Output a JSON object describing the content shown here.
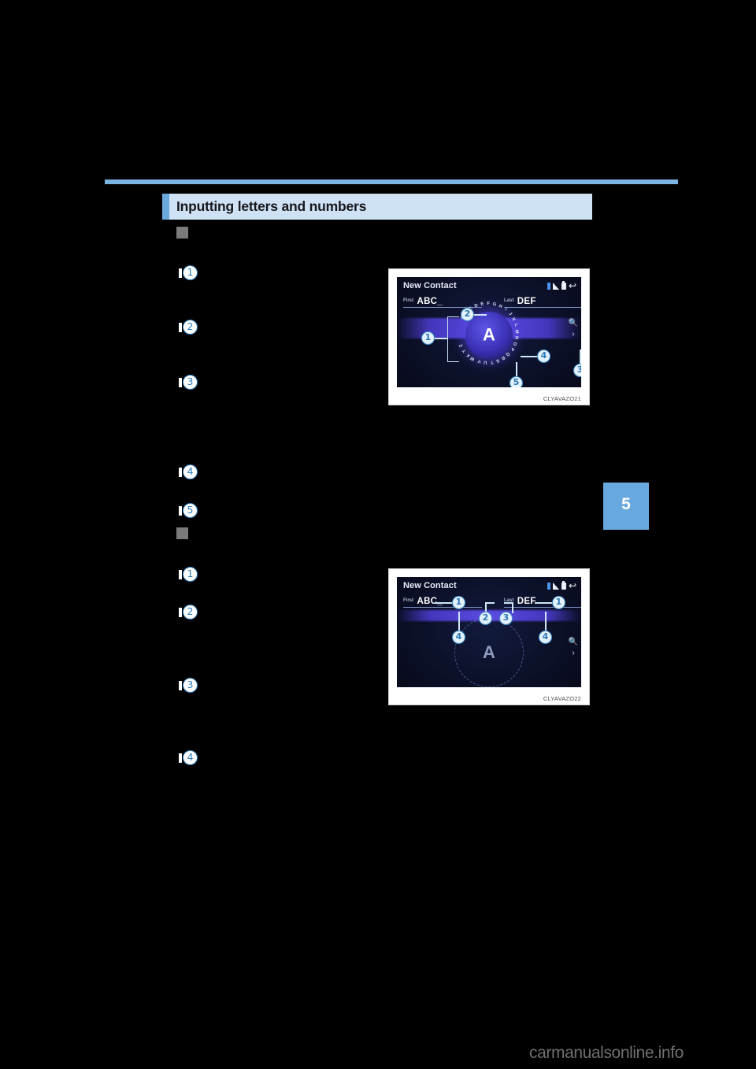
{
  "page": {
    "background_color": "#000000",
    "rule_color": "#7cb3e3",
    "watermark": "carmanualsonline.info"
  },
  "section": {
    "title": "Inputting letters and numbers",
    "title_bg": "#cfe2f5",
    "accent_color": "#6aa9dd"
  },
  "chapter_tab": {
    "number": "5",
    "color": "#67a9df"
  },
  "subsections": [
    {
      "marker": "square",
      "callouts": [
        "1",
        "2",
        "3",
        "4",
        "5"
      ]
    },
    {
      "marker": "square",
      "callouts": [
        "1",
        "2",
        "3",
        "4"
      ]
    }
  ],
  "figures": [
    {
      "caption": "CLYAVAZO21",
      "screen": {
        "title": "New Contact",
        "status_icons": [
          "bluetooth-icon",
          "signal-icon",
          "battery-icon",
          "back-arrow-icon"
        ],
        "fields": [
          {
            "label": "First",
            "value": "ABC_"
          },
          {
            "label": "Last",
            "value": "DEF"
          }
        ],
        "center_character": "A",
        "wheel_characters": [
          "A",
          "B",
          "C",
          "D",
          "E",
          "F",
          "G",
          "H",
          "I",
          "J",
          "K",
          "L",
          "M",
          "N",
          "O",
          "P",
          "Q",
          "R",
          "S",
          "T",
          "U",
          "V",
          "W",
          "X",
          "Y",
          "Z"
        ],
        "side_tools": [
          "search-icon",
          "chevron-right-icon"
        ],
        "callouts": [
          "1",
          "2",
          "3",
          "4",
          "5"
        ]
      }
    },
    {
      "caption": "CLYAVAZO22",
      "screen": {
        "title": "New Contact",
        "status_icons": [
          "bluetooth-icon",
          "signal-icon",
          "battery-icon",
          "back-arrow-icon"
        ],
        "fields": [
          {
            "label": "First",
            "value": "ABC_"
          },
          {
            "label": "Last",
            "value": "DEF"
          }
        ],
        "center_character": "A",
        "side_tools": [
          "search-icon",
          "chevron-right-icon"
        ],
        "callouts": [
          "1",
          "2",
          "3",
          "4"
        ]
      }
    }
  ]
}
